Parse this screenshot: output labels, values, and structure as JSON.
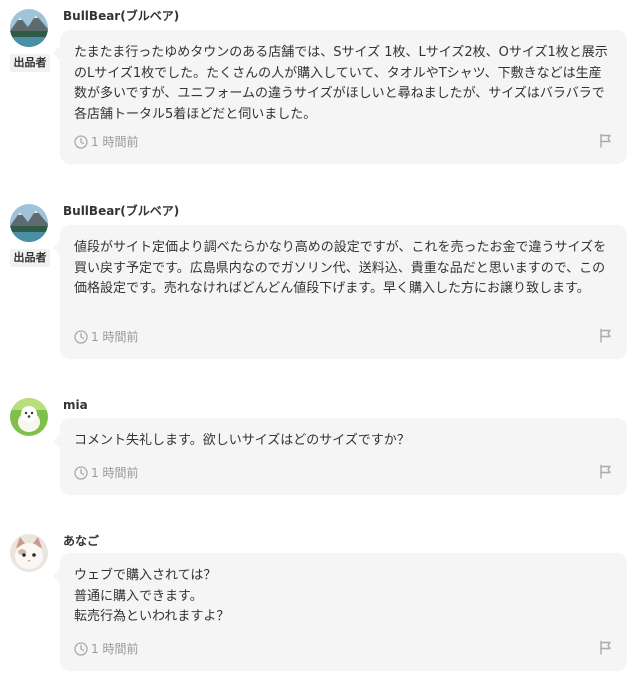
{
  "comments": [
    {
      "username": "BullBear(ブルベア)",
      "seller_badge": "出品者",
      "text": "たまたま行ったゆめタウンのある店舗では、Sサイズ 1枚、Lサイズ2枚、Oサイズ1枚と展示のLサイズ1枚でした。たくさんの人が購入していて、タオルやTシャツ、下敷きなどは生産数が多いですが、ユニフォームの違うサイズがほしいと尋ねましたが、サイズはバラバラで各店舗トータル5着ほどだと伺いました。",
      "time": "1 時間前",
      "avatar": "mountain-lake-avatar"
    },
    {
      "username": "BullBear(ブルベア)",
      "seller_badge": "出品者",
      "text": "値段がサイト定価より調べたらかなり高めの設定ですが、これを売ったお金で違うサイズを買い戻す予定です。広島県内なのでガソリン代、送料込、貴重な品だと思いますので、この価格設定です。売れなければどんどん値段下げます。早く購入した方にお譲り致します。",
      "time": "1 時間前",
      "avatar": "mountain-lake-avatar"
    },
    {
      "username": "mia",
      "seller_badge": "",
      "text": "コメント失礼します。欲しいサイズはどのサイズですか？",
      "time": "1 時間前",
      "avatar": "white-dog-avatar"
    },
    {
      "username": "あなご",
      "seller_badge": "",
      "text": "ウェブで購入されては？\n普通に購入できます。\n転売行為といわれますよ？",
      "time": "1 時間前",
      "avatar": "cat-avatar"
    }
  ],
  "colors": {
    "bubble_bg": "#f5f5f5",
    "badge_bg": "#f1f1f1",
    "muted_text": "#999999",
    "body_text": "#333333"
  }
}
